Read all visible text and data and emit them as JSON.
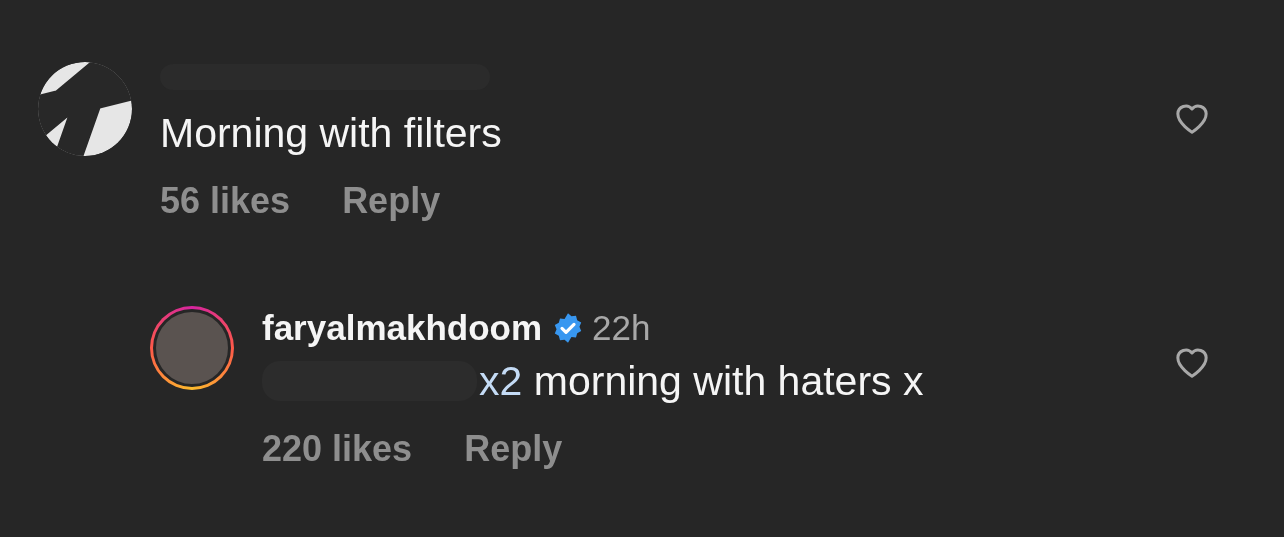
{
  "comments": [
    {
      "kind": "comment",
      "text": "Morning with filters",
      "likes": "56 likes",
      "reply": "Reply",
      "liked": false
    },
    {
      "kind": "reply",
      "username": "faryalmakhdoom",
      "verified": true,
      "time": "22h",
      "mention": "x2",
      "text": "morning with haters x",
      "likes": "220 likes",
      "reply": "Reply",
      "liked": false
    }
  ]
}
